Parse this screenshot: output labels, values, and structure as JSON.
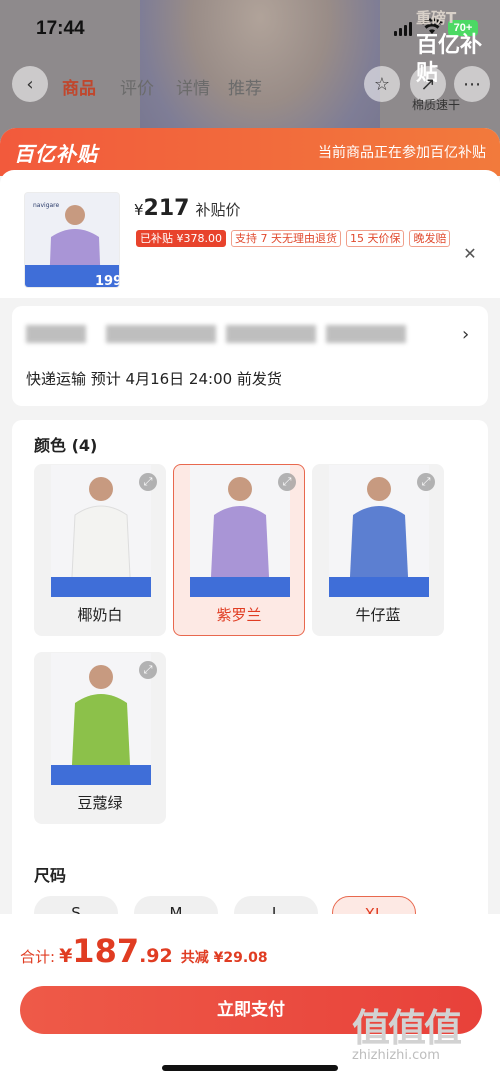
{
  "status_bar": {
    "time": "17:44",
    "battery": "70+"
  },
  "background_page": {
    "tabs": [
      "商品",
      "评价",
      "详情",
      "推荐"
    ],
    "active_tab": 0,
    "brand_corner_top": "重磅T",
    "brand_corner_main": "百亿补贴",
    "side_tag": "棉质速干"
  },
  "banner": {
    "logo": "百亿补贴",
    "note": "当前商品正在参加百亿补贴"
  },
  "product": {
    "currency": "¥",
    "price": "217",
    "price_tag": "补贴价",
    "thumb_brand": "navigare",
    "thumb_price": "199",
    "tags": [
      "已补贴 ¥378.00",
      "支持 7 天无理由退货",
      "15 天价保",
      "晚发赔"
    ]
  },
  "address": {
    "shipping": "快递运输 预计 4月16日 24:00 前发货"
  },
  "colors": {
    "title": "颜色 (4)",
    "items": [
      {
        "name": "椰奶白",
        "shirt": "#f3f3f1",
        "selected": false
      },
      {
        "name": "紫罗兰",
        "shirt": "#a995d6",
        "selected": true
      },
      {
        "name": "牛仔蓝",
        "shirt": "#5c7fd1",
        "selected": false
      },
      {
        "name": "豆蔻绿",
        "shirt": "#8cc14a",
        "selected": false
      }
    ]
  },
  "sizes": {
    "title": "尺码",
    "items": [
      "S",
      "M",
      "L",
      "XL"
    ],
    "selected": "XL"
  },
  "checkout": {
    "total_label": "合计:",
    "yen": "¥",
    "total_int": "187",
    "total_dec": ".92",
    "saving": "共减 ¥29.08",
    "pay_label": "立即支付"
  },
  "watermark": {
    "logo": "值值值",
    "url": "zhizhizhi.com"
  },
  "colors_theme": {
    "accent": "#e8432c",
    "banner_start": "#f25a3c",
    "banner_end": "#f27a3c"
  }
}
